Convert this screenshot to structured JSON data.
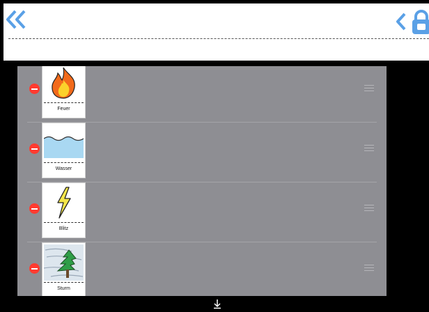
{
  "toolbar": {
    "back_double_icon": "double-chevron-left-icon",
    "back_icon": "chevron-left-icon",
    "lock_icon": "lock-icon",
    "accent_color": "#5aa0e6"
  },
  "list": {
    "items": [
      {
        "label": "Feuer",
        "icon": "fire-icon"
      },
      {
        "label": "Wasser",
        "icon": "water-icon"
      },
      {
        "label": "Blitz",
        "icon": "lightning-icon"
      },
      {
        "label": "Sturm",
        "icon": "storm-icon"
      }
    ],
    "delete_color": "#ff3b30",
    "panel_color": "#8e8e93"
  },
  "footer": {
    "scroll_icon": "arrow-down-icon"
  }
}
